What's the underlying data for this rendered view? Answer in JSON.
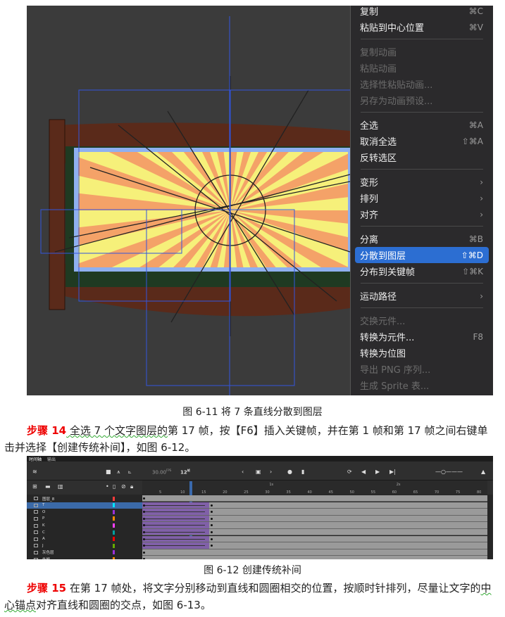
{
  "context_menu": {
    "items": [
      {
        "label": "复制",
        "shortcut": "⌘C",
        "state": "normal"
      },
      {
        "label": "粘贴到中心位置",
        "shortcut": "⌘V",
        "state": "normal"
      },
      {
        "sep": true
      },
      {
        "label": "复制动画",
        "shortcut": "",
        "state": "disabled"
      },
      {
        "label": "粘贴动画",
        "shortcut": "",
        "state": "disabled"
      },
      {
        "label": "选择性粘贴动画...",
        "shortcut": "",
        "state": "disabled"
      },
      {
        "label": "另存为动画预设...",
        "shortcut": "",
        "state": "disabled"
      },
      {
        "sep": true
      },
      {
        "label": "全选",
        "shortcut": "⌘A",
        "state": "normal"
      },
      {
        "label": "取消全选",
        "shortcut": "⇧⌘A",
        "state": "normal"
      },
      {
        "label": "反转选区",
        "shortcut": "",
        "state": "normal"
      },
      {
        "sep": true
      },
      {
        "label": "变形",
        "shortcut": "›",
        "state": "normal"
      },
      {
        "label": "排列",
        "shortcut": "›",
        "state": "normal"
      },
      {
        "label": "对齐",
        "shortcut": "›",
        "state": "normal"
      },
      {
        "sep": true
      },
      {
        "label": "分离",
        "shortcut": "⌘B",
        "state": "normal"
      },
      {
        "label": "分散到图层",
        "shortcut": "⇧⌘D",
        "state": "highlighted"
      },
      {
        "label": "分布到关键帧",
        "shortcut": "⇧⌘K",
        "state": "normal"
      },
      {
        "sep": true
      },
      {
        "label": "运动路径",
        "shortcut": "›",
        "state": "normal"
      },
      {
        "sep": true
      },
      {
        "label": "交换元件...",
        "shortcut": "",
        "state": "disabled"
      },
      {
        "label": "转换为元件...",
        "shortcut": "F8",
        "state": "normal"
      },
      {
        "label": "转换为位图",
        "shortcut": "",
        "state": "normal"
      },
      {
        "label": "导出 PNG 序列...",
        "shortcut": "",
        "state": "disabled"
      },
      {
        "label": "生成 Sprite 表...",
        "shortcut": "",
        "state": "disabled"
      }
    ]
  },
  "caption1": "图 6-11  将 7 条直线分散到图层",
  "step14": {
    "label": "步骤 14",
    "text_a": " 全选 7 个文字图层的",
    "text_b": "第 17 帧，按【F6】插入关键帧，并在第 1 帧和第 17 帧之间右键单击并选择【创建传统补间】，如图 6-12。"
  },
  "timeline": {
    "tabs": [
      "时间轴",
      "输出"
    ],
    "fps": "30.00",
    "fps_unit": "FPS",
    "frame": "12",
    "frame_unit": "帧",
    "ticks": [
      "5",
      "10",
      "15",
      "20",
      "25",
      "30",
      "35",
      "40",
      "45",
      "50",
      "55",
      "60",
      "65",
      "70",
      "75",
      "80"
    ],
    "second_marks": [
      "1s",
      "2s"
    ],
    "playhead_frame": 12,
    "tween_start": 1,
    "tween_end": 17,
    "layers": [
      {
        "name": "图层_8",
        "color": "#ff3b3b",
        "tween": false,
        "selected": false
      },
      {
        "name": "T",
        "color": "#00e5ff",
        "tween": true,
        "selected": true
      },
      {
        "name": "O",
        "color": "#9b30d9",
        "tween": true,
        "selected": false
      },
      {
        "name": "P",
        "color": "#ff8c00",
        "tween": true,
        "selected": false
      },
      {
        "name": "K",
        "color": "#ff40ff",
        "tween": true,
        "selected": false
      },
      {
        "name": "C",
        "color": "#00a0a0",
        "tween": true,
        "selected": false
      },
      {
        "name": "A",
        "color": "#ff0000",
        "tween": true,
        "selected": false
      },
      {
        "name": "J",
        "color": "#66aa00",
        "tween": true,
        "selected": false
      },
      {
        "name": "灰色层",
        "color": "#9b30d9",
        "tween": false,
        "selected": false
      },
      {
        "name": "外框",
        "color": "#ff8c00",
        "tween": false,
        "selected": false
      }
    ]
  },
  "caption2": "图 6-12  创建传统补间",
  "step15": {
    "label": "步骤 15",
    "text_a": " 在第 17 帧处，将文字分别移动到直线和圆圈相交的位置，按顺时针排列，尽量让文字的",
    "text_u": "中心锚点",
    "text_b": "对齐直线和圆圈的交点，如图 6-13。"
  }
}
